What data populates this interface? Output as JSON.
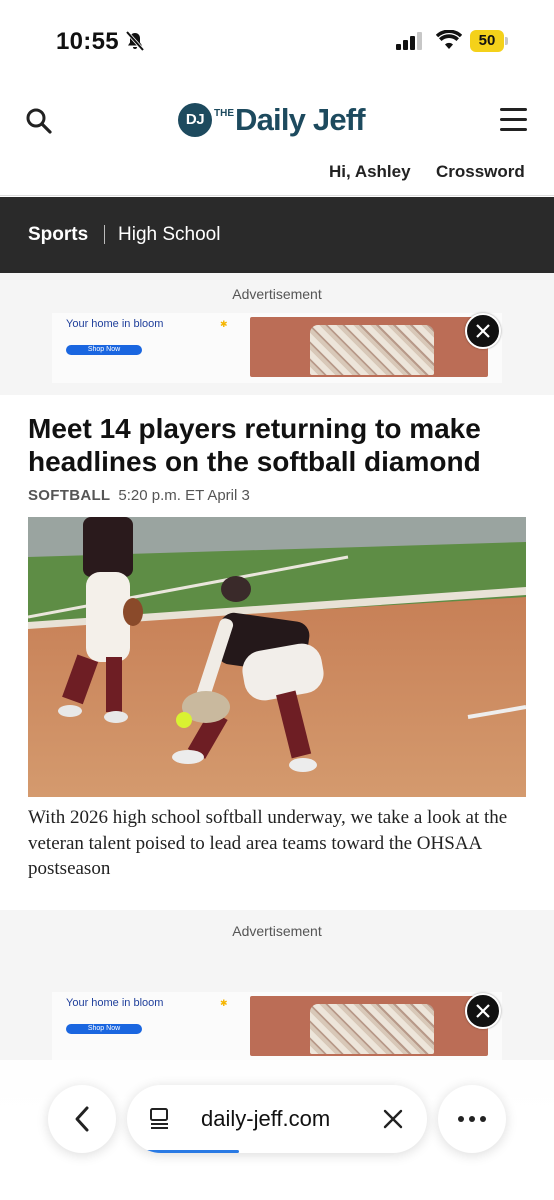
{
  "status_bar": {
    "time": "10:55",
    "battery": "50",
    "icons": [
      "bell-slash-icon",
      "cellular-signal-icon",
      "wifi-icon",
      "battery-icon"
    ]
  },
  "header": {
    "logo_initials": "DJ",
    "logo_prefix": "THE",
    "logo_name": "Daily Jeff",
    "greeting": "Hi, Ashley",
    "crossword": "Crossword",
    "icons": [
      "search-icon",
      "hamburger-menu-icon"
    ]
  },
  "section": {
    "main": "Sports",
    "sub": "High School"
  },
  "ads": [
    {
      "label": "Advertisement",
      "headline": "Your home in bloom",
      "cta": "Shop Now"
    },
    {
      "label": "Advertisement",
      "headline": "Your home in bloom",
      "cta": "Shop Now"
    }
  ],
  "article": {
    "headline": "Meet 14 players returning to make headlines on the softball diamond",
    "category": "SOFTBALL",
    "timestamp": "5:20 p.m. ET April 3",
    "photo_icon": "softball-players-photo",
    "summary": "With 2026 high school softball underway, we take a look at the veteran talent poised to lead area teams toward the OHSAA postseason"
  },
  "browser": {
    "url": "daily-jeff.com",
    "icons": [
      "back-chevron-icon",
      "reader-icon",
      "close-icon",
      "more-icon"
    ]
  },
  "colors": {
    "brand": "#1d4a5e",
    "section_bar": "#2a2a2a",
    "battery": "#f4d11a",
    "progress": "#2a7ae4"
  }
}
